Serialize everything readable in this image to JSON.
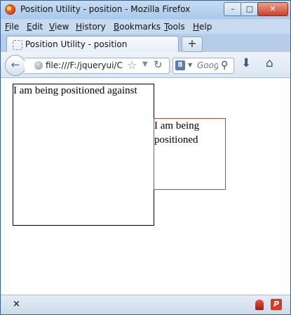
{
  "window": {
    "title": "Position Utility - position - Mozilla Firefox",
    "controls": {
      "minimize": "–",
      "maximize": "□",
      "close": "✕"
    }
  },
  "menubar": {
    "items": [
      "File",
      "Edit",
      "View",
      "History",
      "Bookmarks",
      "Tools",
      "Help"
    ]
  },
  "tabs": [
    {
      "label": "Position Utility - position",
      "icon": "page-icon"
    }
  ],
  "new_tab": "+",
  "navbar": {
    "url": "file:///F:/jqueryui/Ch",
    "search_placeholder": "Goog",
    "icons": [
      "back-icon",
      "globe-icon",
      "star-icon",
      "dropdown-icon",
      "reload-icon",
      "google-icon",
      "search-icon",
      "download-icon",
      "home-icon"
    ]
  },
  "content": {
    "target_text": "I am being positioned against",
    "positioned_text": "I am being positioned",
    "colors": {
      "positioned_border": "#b64a2e",
      "target_border": "#000000"
    }
  },
  "statusbar": {
    "close": "×",
    "addon_label": "P"
  }
}
